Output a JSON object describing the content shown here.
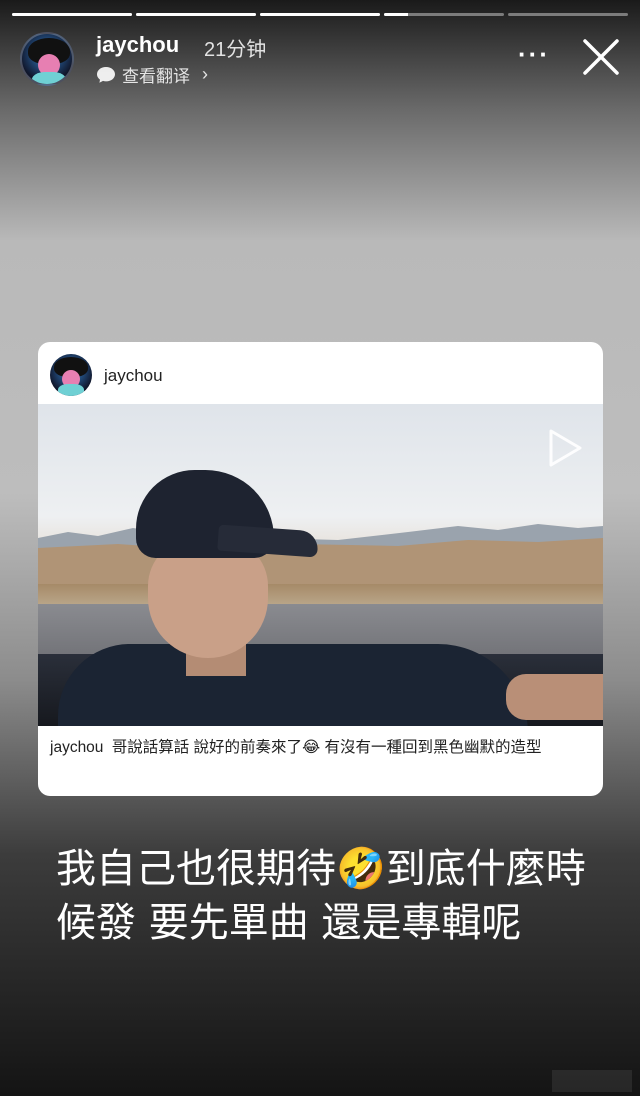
{
  "story": {
    "progress": [
      1.0,
      1.0,
      1.0,
      0.2,
      0.0
    ]
  },
  "header": {
    "username": "jaychou",
    "time_ago": "21分钟",
    "translate_label": "查看翻译",
    "translate_chevron": "›",
    "more_icon": "more-dots-icon",
    "close_icon": "close-icon"
  },
  "card": {
    "username": "jaychou",
    "caption_user": "jaychou",
    "caption_text": "哥說話算話 說好的前奏來了😂 有沒有一種回到黑色幽默的造型"
  },
  "story_text": "我自己也很期待🤣到底什麼時候發 要先單曲 還是專輯呢"
}
